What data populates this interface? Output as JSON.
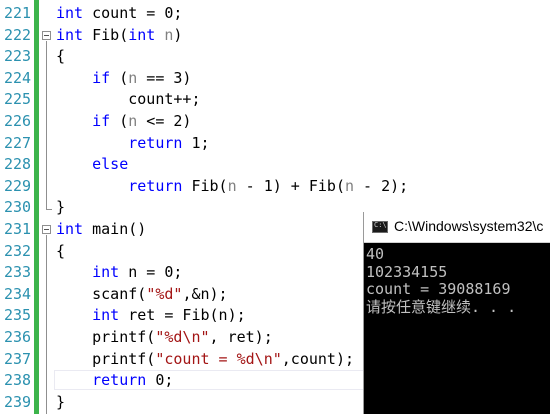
{
  "editor": {
    "lines": [
      {
        "num": "221",
        "tokens": [
          [
            "kw",
            "int"
          ],
          [
            "id",
            " count = 0;"
          ]
        ]
      },
      {
        "num": "222",
        "tokens": [
          [
            "kw",
            "int"
          ],
          [
            "id",
            " Fib("
          ],
          [
            "kw",
            "int"
          ],
          [
            "id",
            " "
          ],
          [
            "param",
            "n"
          ],
          [
            "id",
            ")"
          ]
        ]
      },
      {
        "num": "223",
        "tokens": [
          [
            "id",
            "{"
          ]
        ]
      },
      {
        "num": "224",
        "tokens": [
          [
            "id",
            "    "
          ],
          [
            "kw",
            "if"
          ],
          [
            "id",
            " ("
          ],
          [
            "param",
            "n"
          ],
          [
            "id",
            " == 3)"
          ]
        ]
      },
      {
        "num": "225",
        "tokens": [
          [
            "id",
            "        count++;"
          ]
        ]
      },
      {
        "num": "226",
        "tokens": [
          [
            "id",
            "    "
          ],
          [
            "kw",
            "if"
          ],
          [
            "id",
            " ("
          ],
          [
            "param",
            "n"
          ],
          [
            "id",
            " <= 2)"
          ]
        ]
      },
      {
        "num": "227",
        "tokens": [
          [
            "id",
            "        "
          ],
          [
            "kw",
            "return"
          ],
          [
            "id",
            " 1;"
          ]
        ]
      },
      {
        "num": "228",
        "tokens": [
          [
            "id",
            "    "
          ],
          [
            "kw",
            "else"
          ]
        ]
      },
      {
        "num": "229",
        "tokens": [
          [
            "id",
            "        "
          ],
          [
            "kw",
            "return"
          ],
          [
            "id",
            " Fib("
          ],
          [
            "param",
            "n"
          ],
          [
            "id",
            " - 1) + Fib("
          ],
          [
            "param",
            "n"
          ],
          [
            "id",
            " - 2);"
          ]
        ]
      },
      {
        "num": "230",
        "tokens": [
          [
            "id",
            "}"
          ]
        ]
      },
      {
        "num": "231",
        "tokens": [
          [
            "kw",
            "int"
          ],
          [
            "id",
            " main()"
          ]
        ]
      },
      {
        "num": "232",
        "tokens": [
          [
            "id",
            "{"
          ]
        ]
      },
      {
        "num": "233",
        "tokens": [
          [
            "id",
            "    "
          ],
          [
            "kw",
            "int"
          ],
          [
            "id",
            " n = 0;"
          ]
        ]
      },
      {
        "num": "234",
        "tokens": [
          [
            "id",
            "    scanf("
          ],
          [
            "str",
            "\"%d\""
          ],
          [
            "id",
            ",&n);"
          ]
        ]
      },
      {
        "num": "235",
        "tokens": [
          [
            "id",
            "    "
          ],
          [
            "kw",
            "int"
          ],
          [
            "id",
            " ret = Fib(n);"
          ]
        ]
      },
      {
        "num": "236",
        "tokens": [
          [
            "id",
            "    printf("
          ],
          [
            "str",
            "\"%d\\n\""
          ],
          [
            "id",
            ", ret);"
          ]
        ]
      },
      {
        "num": "237",
        "tokens": [
          [
            "id",
            "    printf("
          ],
          [
            "str",
            "\"count = %d\\n\""
          ],
          [
            "id",
            ",count);"
          ]
        ]
      },
      {
        "num": "238",
        "tokens": [
          [
            "id",
            "    "
          ],
          [
            "kw",
            "return"
          ],
          [
            "id",
            " 0;"
          ]
        ]
      },
      {
        "num": "239",
        "tokens": [
          [
            "id",
            "}"
          ]
        ]
      }
    ]
  },
  "console": {
    "title": "C:\\Windows\\system32\\c",
    "output": [
      "40",
      "102334155",
      "count = 39088169",
      "请按任意键继续. . ."
    ]
  },
  "colors": {
    "keyword": "#0000ff",
    "string": "#a31515",
    "line_number": "#2b91af",
    "change_bar": "#3cb44b",
    "console_bg": "#000000",
    "console_text": "#c0c0c0"
  }
}
